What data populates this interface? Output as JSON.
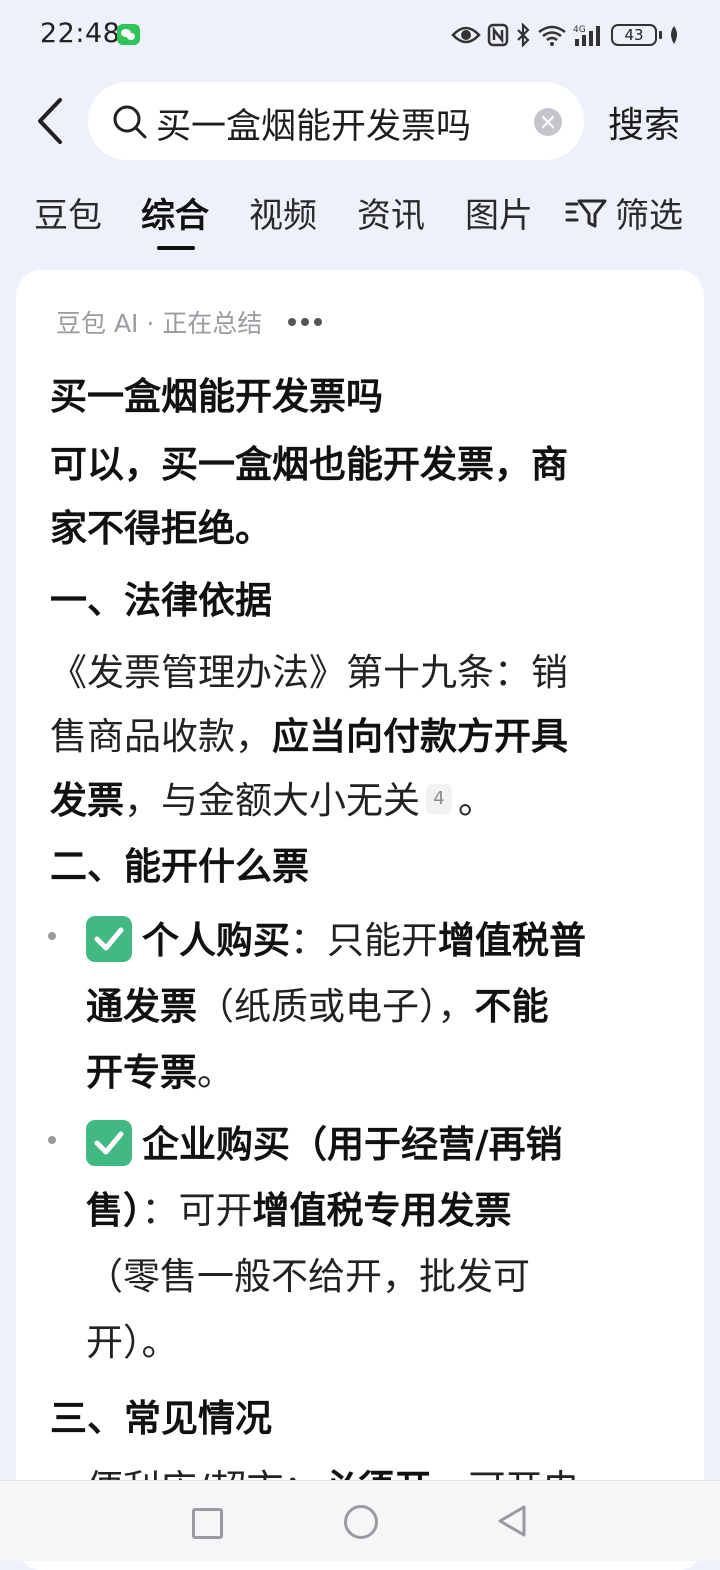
{
  "status_bar": {
    "time": "22:48",
    "battery": "43",
    "network": "4G"
  },
  "search": {
    "query": "买一盒烟能开发票吗",
    "button_label": "搜索"
  },
  "tabs": [
    {
      "label": "豆包"
    },
    {
      "label": "综合",
      "active": true
    },
    {
      "label": "视频"
    },
    {
      "label": "资讯"
    },
    {
      "label": "图片"
    }
  ],
  "filter_label": "筛选",
  "ai_answer": {
    "status": "豆包 AI · 正在总结",
    "title": "买一盒烟能开发票吗",
    "summary_line1": "可以，买一盒烟也能开发票，商",
    "summary_line2": "家不得拒绝。",
    "section1_heading": "一、法律依据",
    "section1_line1": "《发票管理办法》第十九条：销",
    "section1_line2a": "售商品收款，",
    "section1_line2b": "应当向付款方开具",
    "section1_line3a": "发票",
    "section1_line3b": "，与金额大小无关",
    "section1_ref": "4",
    "section1_line3c": "。",
    "section2_heading": "二、能开什么票",
    "bullet1": {
      "a": "个人购买",
      "b": "：只能开",
      "c": "增值税普",
      "d": "通发票",
      "e": "（纸质或电子），",
      "f": "不能",
      "g": "开专票",
      "h": "。"
    },
    "bullet2": {
      "a": "企业购买（用于经营/再销",
      "b": "售）",
      "c": "：可开",
      "d": "增值税专用发票",
      "e": "（零售一般不给开，批发可",
      "f": "开）。"
    },
    "section3_heading": "三、常见情况",
    "cutoff_a": "便利店/超市：",
    "cutoff_b": "必须开",
    "cutoff_c": "，可开电"
  },
  "colors": {
    "background": "#eef1f9",
    "check": "#42b883"
  }
}
